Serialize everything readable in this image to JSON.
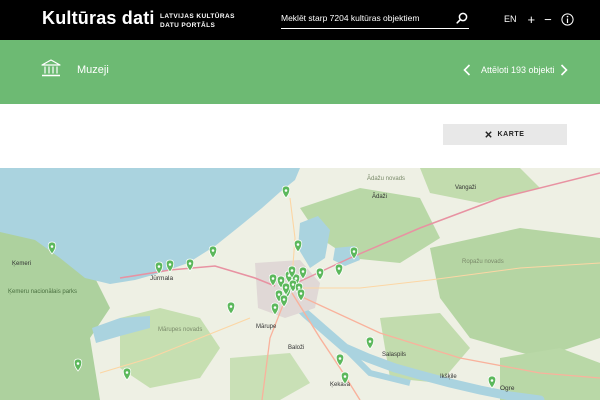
{
  "header": {
    "logo": "Kultūras dati",
    "tagline": "LATVIJAS KULTŪRAS DATU PORTĀLS",
    "search_placeholder": "Meklēt starp 7204 kultūras objektiem",
    "search_icon": "search-icon",
    "lang": "EN",
    "zoom_in": "+",
    "zoom_out": "−",
    "info_icon": "info-icon"
  },
  "category": {
    "icon": "museum-icon",
    "title": "Muzeji",
    "count_label": "Attēloti 193 objekti"
  },
  "toolbar": {
    "karte_label": "KARTE"
  },
  "colors": {
    "header_bg": "#000000",
    "accent_green": "#6dba73",
    "marker_green": "#5cb85c",
    "water": "#aad3df",
    "forest": "#add19e"
  },
  "map": {
    "labels": [
      {
        "name": "Ādažu novads"
      },
      {
        "name": "Ādaži"
      },
      {
        "name": "Vangaži"
      },
      {
        "name": "Jūrmala"
      },
      {
        "name": "Ķemeru nacionālais parks"
      },
      {
        "name": "Ķemeri"
      },
      {
        "name": "Mārupes novads"
      },
      {
        "name": "Mārupe"
      },
      {
        "name": "Baloži"
      },
      {
        "name": "Ķekava"
      },
      {
        "name": "Salaspils"
      },
      {
        "name": "Ikšķile"
      },
      {
        "name": "Ogre"
      },
      {
        "name": "Ropažu novads"
      }
    ]
  }
}
